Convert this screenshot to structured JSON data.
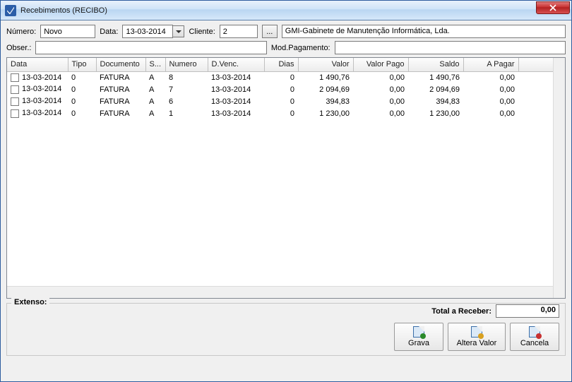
{
  "window": {
    "title": "Recebimentos (RECIBO)"
  },
  "form": {
    "numero_label": "Número:",
    "numero_value": "Novo",
    "data_label": "Data:",
    "data_value": "13-03-2014",
    "cliente_label": "Cliente:",
    "cliente_value": "2",
    "cliente_desc": "GMI-Gabinete de Manutenção Informática, Lda.",
    "obser_label": "Obser.:",
    "obser_value": "",
    "modpag_label": "Mod.Pagamento:",
    "modpag_value": ""
  },
  "columns": {
    "data": "Data",
    "tipo": "Tipo",
    "documento": "Documento",
    "s": "S...",
    "numero": "Numero",
    "dvenc": "D.Venc.",
    "dias": "Dias",
    "valor": "Valor",
    "valor_pago": "Valor Pago",
    "saldo": "Saldo",
    "a_pagar": "A Pagar"
  },
  "rows": [
    {
      "data": "13-03-2014",
      "tipo": "0",
      "documento": "FATURA",
      "s": "A",
      "numero": "8",
      "dvenc": "13-03-2014",
      "dias": "0",
      "valor": "1 490,76",
      "valor_pago": "0,00",
      "saldo": "1 490,76",
      "a_pagar": "0,00"
    },
    {
      "data": "13-03-2014",
      "tipo": "0",
      "documento": "FATURA",
      "s": "A",
      "numero": "7",
      "dvenc": "13-03-2014",
      "dias": "0",
      "valor": "2 094,69",
      "valor_pago": "0,00",
      "saldo": "2 094,69",
      "a_pagar": "0,00"
    },
    {
      "data": "13-03-2014",
      "tipo": "0",
      "documento": "FATURA",
      "s": "A",
      "numero": "6",
      "dvenc": "13-03-2014",
      "dias": "0",
      "valor": "394,83",
      "valor_pago": "0,00",
      "saldo": "394,83",
      "a_pagar": "0,00"
    },
    {
      "data": "13-03-2014",
      "tipo": "0",
      "documento": "FATURA",
      "s": "A",
      "numero": "1",
      "dvenc": "13-03-2014",
      "dias": "0",
      "valor": "1 230,00",
      "valor_pago": "0,00",
      "saldo": "1 230,00",
      "a_pagar": "0,00"
    }
  ],
  "footer": {
    "extenso_label": "Extenso:",
    "total_label": "Total a Receber:",
    "total_value": "0,00",
    "grava": "Grava",
    "altera": "Altera Valor",
    "cancela": "Cancela"
  },
  "dots": "..."
}
